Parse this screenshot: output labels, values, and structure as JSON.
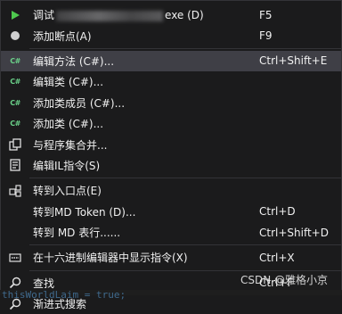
{
  "menu": {
    "items": [
      {
        "label_prefix": "调试",
        "label_suffix": "exe (D)",
        "shortcut": "F5",
        "icon": "play-icon"
      },
      {
        "label": "添加断点(A)",
        "shortcut": "F9",
        "icon": "breakpoint-icon"
      },
      {
        "label": "编辑方法 (C#)...",
        "shortcut": "Ctrl+Shift+E",
        "icon": "csharp-icon"
      },
      {
        "label": "编辑类 (C#)...",
        "shortcut": "",
        "icon": "csharp-icon"
      },
      {
        "label": "添加类成员 (C#)...",
        "shortcut": "",
        "icon": "csharp-icon"
      },
      {
        "label": "添加类 (C#)...",
        "shortcut": "",
        "icon": "csharp-icon"
      },
      {
        "label": "与程序集合并...",
        "shortcut": "",
        "icon": "merge-icon"
      },
      {
        "label": "编辑IL指令(S)",
        "shortcut": "",
        "icon": "il-icon"
      },
      {
        "label": "转到入口点(E)",
        "shortcut": "",
        "icon": "entry-point-icon"
      },
      {
        "label": "转到MD Token (D)...",
        "shortcut": "Ctrl+D",
        "icon": ""
      },
      {
        "label": "转到 MD 表行......",
        "shortcut": "Ctrl+Shift+D",
        "icon": ""
      },
      {
        "label": "在十六进制编辑器中显示指令(X)",
        "shortcut": "Ctrl+X",
        "icon": "hex-editor-icon"
      },
      {
        "label": "查找",
        "shortcut": "Ctrl+F",
        "icon": "search-icon"
      },
      {
        "label": "渐进式搜索",
        "shortcut": "Ctrl+I",
        "icon": "search-icon"
      }
    ]
  },
  "watermark": "CSDN @雅格小京",
  "code_fragment": "thisWorldLaim = true;",
  "colors": {
    "menu_bg": "#1b1b1c",
    "highlight": "#3f3f46",
    "play": "#4ec94e",
    "csharp": "#6bd28a"
  }
}
